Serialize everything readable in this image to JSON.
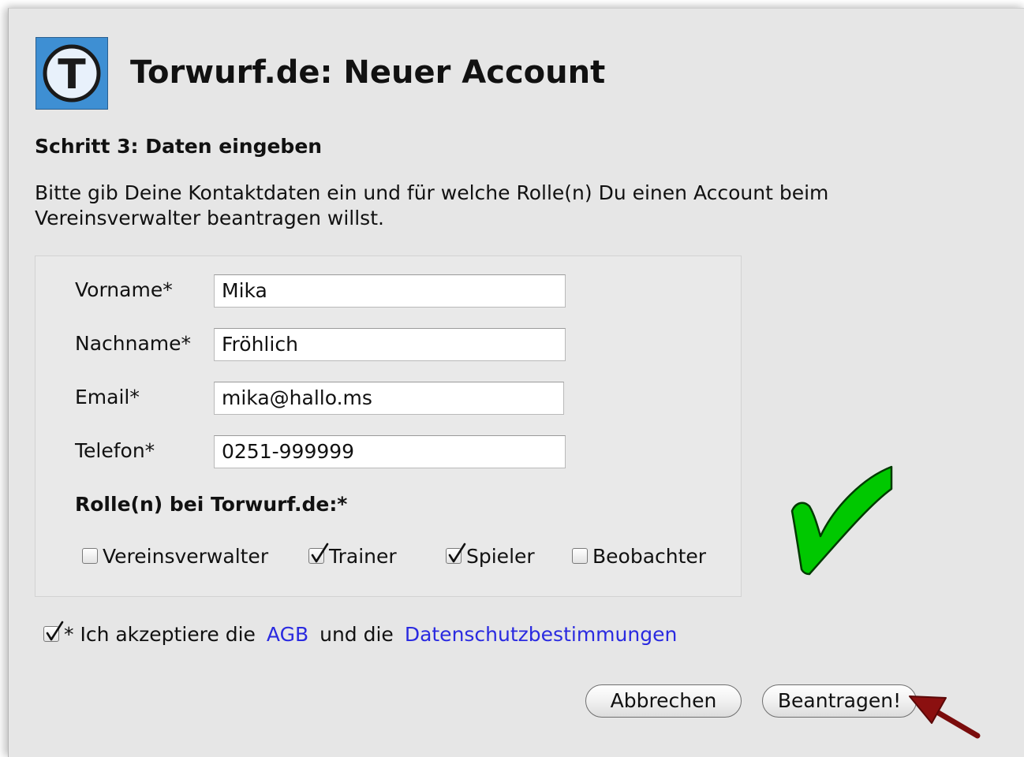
{
  "header": {
    "logo_letter": "T",
    "title": "Torwurf.de: Neuer Account"
  },
  "step_title": "Schritt 3: Daten eingeben",
  "intro": "Bitte gib Deine Kontaktdaten ein und für welche Rolle(n) Du einen Account beim Vereinsverwalter beantragen willst.",
  "form": {
    "fields": [
      {
        "label": "Vorname*",
        "value": "Mika"
      },
      {
        "label": "Nachname*",
        "value": "Fröhlich"
      },
      {
        "label": "Email*",
        "value": "mika@hallo.ms"
      },
      {
        "label": "Telefon*",
        "value": "0251-999999"
      }
    ],
    "roles_heading": "Rolle(n) bei Torwurf.de:*",
    "roles": [
      {
        "label": "Vereinsverwalter",
        "checked": false
      },
      {
        "label": "Trainer",
        "checked": true
      },
      {
        "label": "Spieler",
        "checked": true
      },
      {
        "label": "Beobachter",
        "checked": false
      }
    ]
  },
  "agreement": {
    "checked": true,
    "prefix": "* Ich akzeptiere die",
    "agb_link": "AGB",
    "middle": "und die",
    "privacy_link": "Datenschutzbestimmungen"
  },
  "buttons": {
    "cancel": "Abbrechen",
    "submit": "Beantragen!"
  },
  "colors": {
    "logo_blue": "#3e8fd3",
    "link_blue": "#2a2ae0",
    "checkmark_green": "#00c800",
    "arrow_red": "#8b1010"
  },
  "annotations": {
    "success_checkmark_icon": "checkmark-icon",
    "pointer_arrow_icon": "arrow-icon"
  }
}
